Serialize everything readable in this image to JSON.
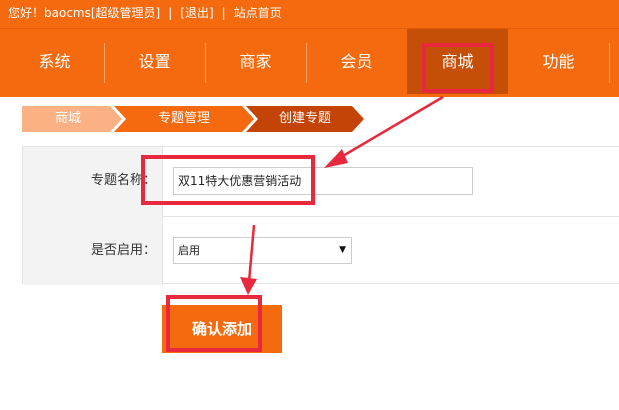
{
  "topbar": {
    "greeting": "您好！baocms[超级管理员]",
    "sep1": "|",
    "logout": "[退出]",
    "sep2": "|",
    "home": "站点首页"
  },
  "nav": {
    "items": [
      "系统",
      "设置",
      "商家",
      "会员",
      "商城",
      "功能"
    ],
    "active": "商城"
  },
  "breadcrumb": [
    "商城",
    "专题管理",
    "创建专题"
  ],
  "form": {
    "name_label": "专题名称：",
    "name_value": "双11特大优惠营销活动",
    "enable_label": "是否启用：",
    "enable_value": "启用"
  },
  "submit_label": "确认添加",
  "colors": {
    "brand": "#f56a0e",
    "nav_active": "#c54f06",
    "annotation": "#e8283c"
  }
}
